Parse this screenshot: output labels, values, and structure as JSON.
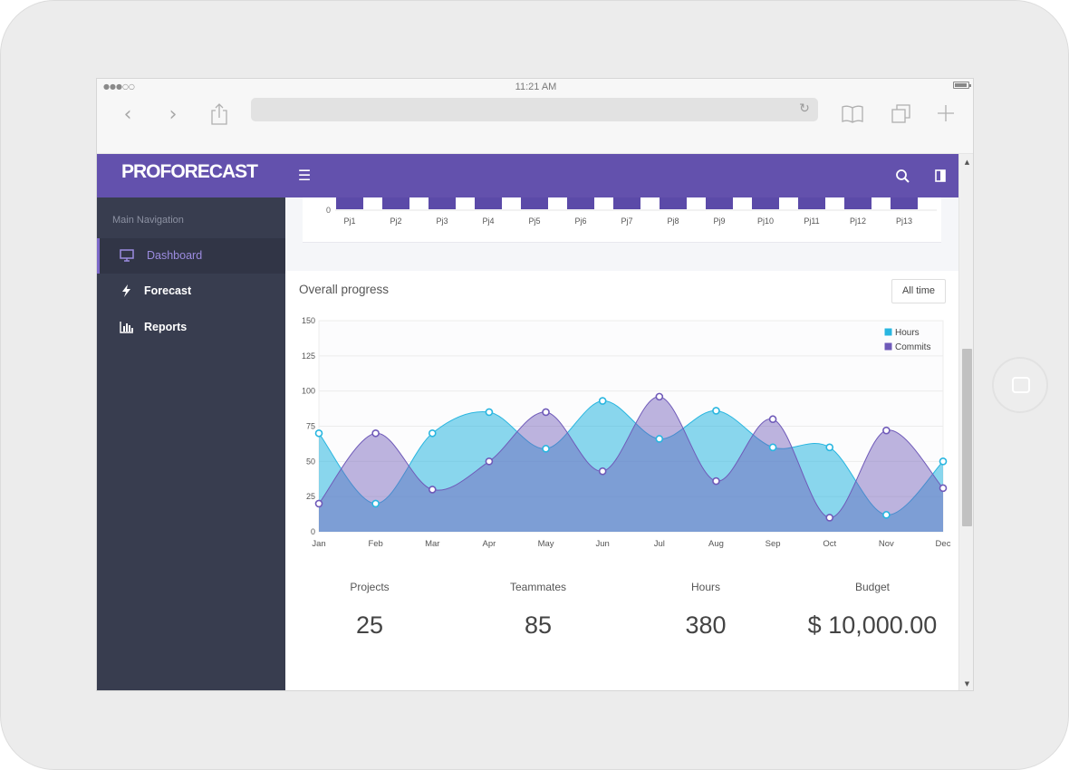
{
  "device": {
    "time": "11:21 AM",
    "signal": "●●●○○"
  },
  "browser": {
    "url": ""
  },
  "app": {
    "brand": "PROFORECAST"
  },
  "sidebar": {
    "title": "Main Navigation",
    "items": [
      {
        "label": "Dashboard",
        "icon": "monitor-icon",
        "active": true
      },
      {
        "label": "Forecast",
        "icon": "bolt-icon",
        "active": false
      },
      {
        "label": "Reports",
        "icon": "bar-chart-icon",
        "active": false
      }
    ]
  },
  "projects_chart": {
    "categories": [
      "Pj1",
      "Pj2",
      "Pj3",
      "Pj4",
      "Pj5",
      "Pj6",
      "Pj7",
      "Pj8",
      "Pj9",
      "Pj10",
      "Pj11",
      "Pj12",
      "Pj13"
    ],
    "zero_label": "0"
  },
  "progress": {
    "title": "Overall progress",
    "range_button": "All time"
  },
  "chart_data": {
    "type": "area",
    "x": [
      "Jan",
      "Feb",
      "Mar",
      "Apr",
      "May",
      "Jun",
      "Jul",
      "Aug",
      "Sep",
      "Oct",
      "Nov",
      "Dec"
    ],
    "ylim": [
      0,
      150
    ],
    "yticks": [
      0,
      25,
      50,
      75,
      100,
      125,
      150
    ],
    "grid": true,
    "legend": "top-right",
    "series": [
      {
        "name": "Hours",
        "color": "#29b6e0",
        "values": [
          70,
          20,
          70,
          85,
          59,
          93,
          66,
          86,
          60,
          60,
          12,
          50
        ]
      },
      {
        "name": "Commits",
        "color": "#6f5ab9",
        "values": [
          20,
          70,
          30,
          50,
          85,
          43,
          96,
          36,
          80,
          10,
          72,
          31
        ]
      }
    ]
  },
  "stats": [
    {
      "label": "Projects",
      "value": "25"
    },
    {
      "label": "Teammates",
      "value": "85"
    },
    {
      "label": "Hours",
      "value": "380"
    },
    {
      "label": "Budget",
      "value": "$ 10,000.00"
    }
  ],
  "colors": {
    "brand": "#6351ad",
    "sidebar": "#383d4f",
    "hours": "#29b6e0",
    "commits": "#6f5ab9"
  }
}
